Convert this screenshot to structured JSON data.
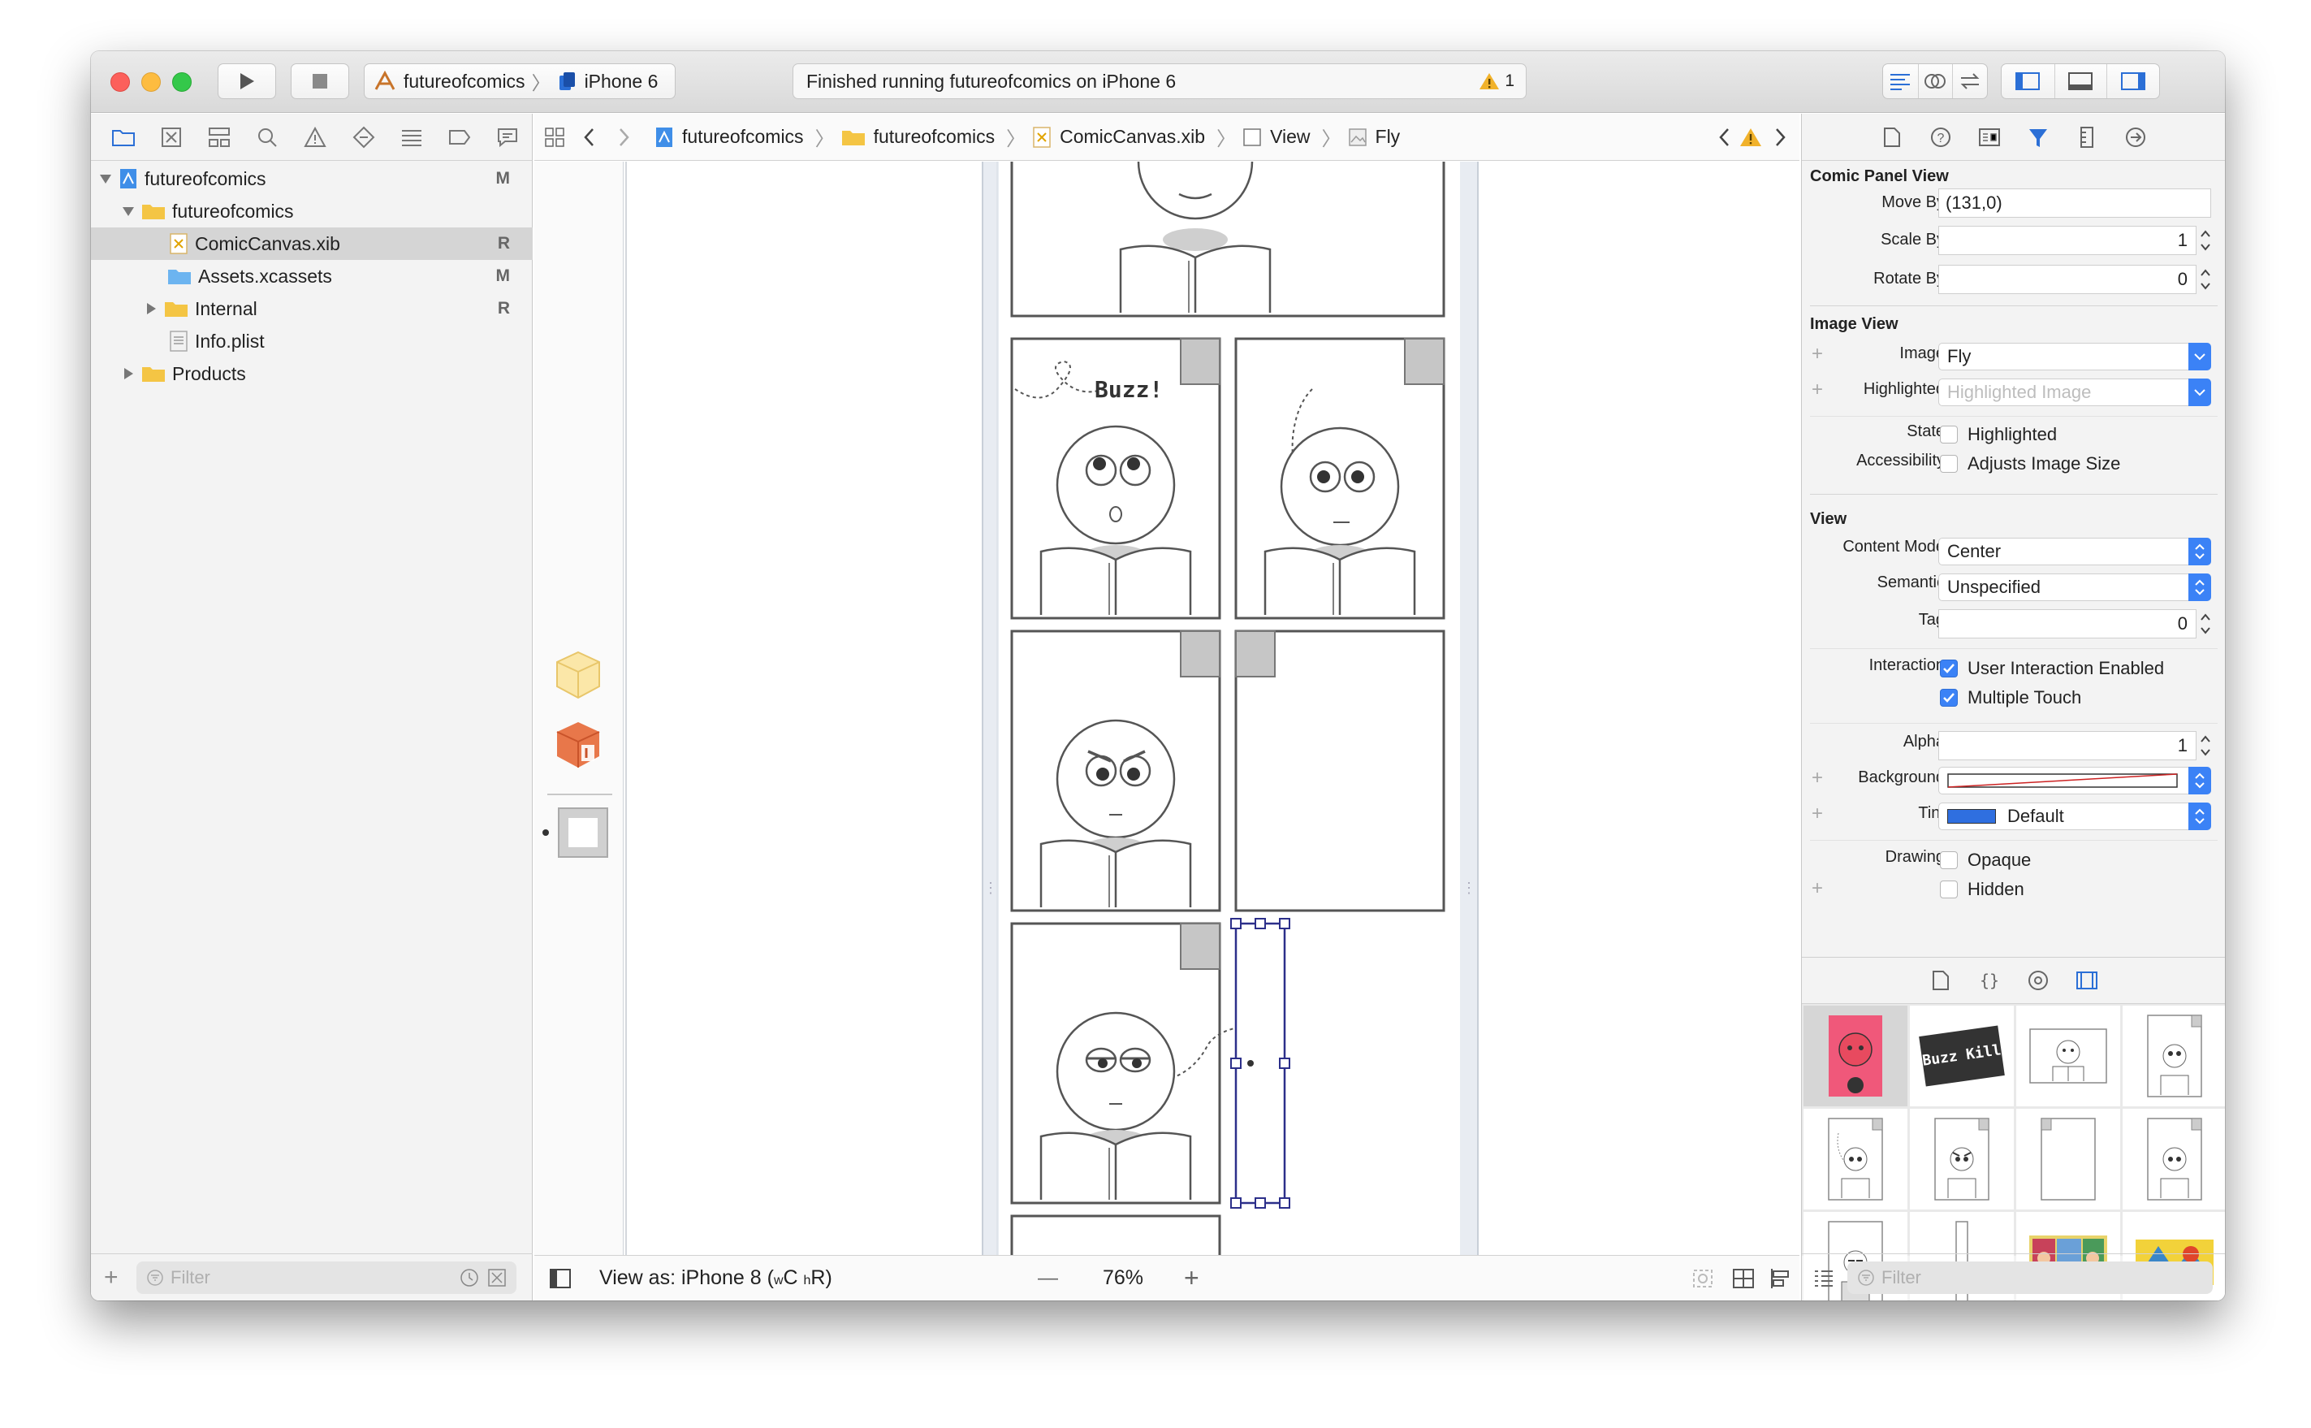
{
  "toolbar": {
    "scheme_project": "futureofcomics",
    "scheme_device": "iPhone 6",
    "status_text": "Finished running futureofcomics on iPhone 6",
    "warning_count": "1"
  },
  "navigator": {
    "items": [
      {
        "label": "futureofcomics",
        "badge": "M"
      },
      {
        "label": "futureofcomics",
        "badge": ""
      },
      {
        "label": "ComicCanvas.xib",
        "badge": "R"
      },
      {
        "label": "Assets.xcassets",
        "badge": "M"
      },
      {
        "label": "Internal",
        "badge": "R"
      },
      {
        "label": "Info.plist",
        "badge": ""
      },
      {
        "label": "Products",
        "badge": ""
      }
    ],
    "filter_placeholder": "Filter"
  },
  "jumpbar": {
    "crumbs": [
      "futureofcomics",
      "futureofcomics",
      "ComicCanvas.xib",
      "View",
      "Fly"
    ]
  },
  "canvas": {
    "buzz_text": "Buzz!"
  },
  "bottombar": {
    "view_as": "View as: iPhone 8 (",
    "w_small": "w",
    "w_cap": "C ",
    "h_small": "h",
    "h_cap": "R)",
    "zoom": "76%",
    "minus": "—",
    "plus": "+"
  },
  "inspector": {
    "comic_panel_view": {
      "title": "Comic Panel View",
      "move_by_label": "Move By",
      "move_by": "(131,0)",
      "scale_by_label": "Scale By",
      "scale_by": "1",
      "rotate_by_label": "Rotate By",
      "rotate_by": "0"
    },
    "image_view": {
      "title": "Image View",
      "image_label": "Image",
      "image": "Fly",
      "highlighted_label": "Highlighted",
      "highlighted_placeholder": "Highlighted Image",
      "state_label": "State",
      "state_option": "Highlighted",
      "accessibility_label": "Accessibility",
      "accessibility_option": "Adjusts Image Size"
    },
    "view": {
      "title": "View",
      "content_mode_label": "Content Mode",
      "content_mode": "Center",
      "semantic_label": "Semantic",
      "semantic": "Unspecified",
      "tag_label": "Tag",
      "tag": "0",
      "interaction_label": "Interaction",
      "user_interaction": "User Interaction Enabled",
      "multiple_touch": "Multiple Touch",
      "alpha_label": "Alpha",
      "alpha": "1",
      "background_label": "Background",
      "tint_label": "Tint",
      "tint": "Default",
      "tint_color": "#2f6fe0",
      "drawing_label": "Drawing",
      "opaque": "Opaque",
      "hidden": "Hidden"
    },
    "library": {
      "buzz_kill": "Buzz Kill",
      "filter_placeholder": "Filter"
    }
  }
}
